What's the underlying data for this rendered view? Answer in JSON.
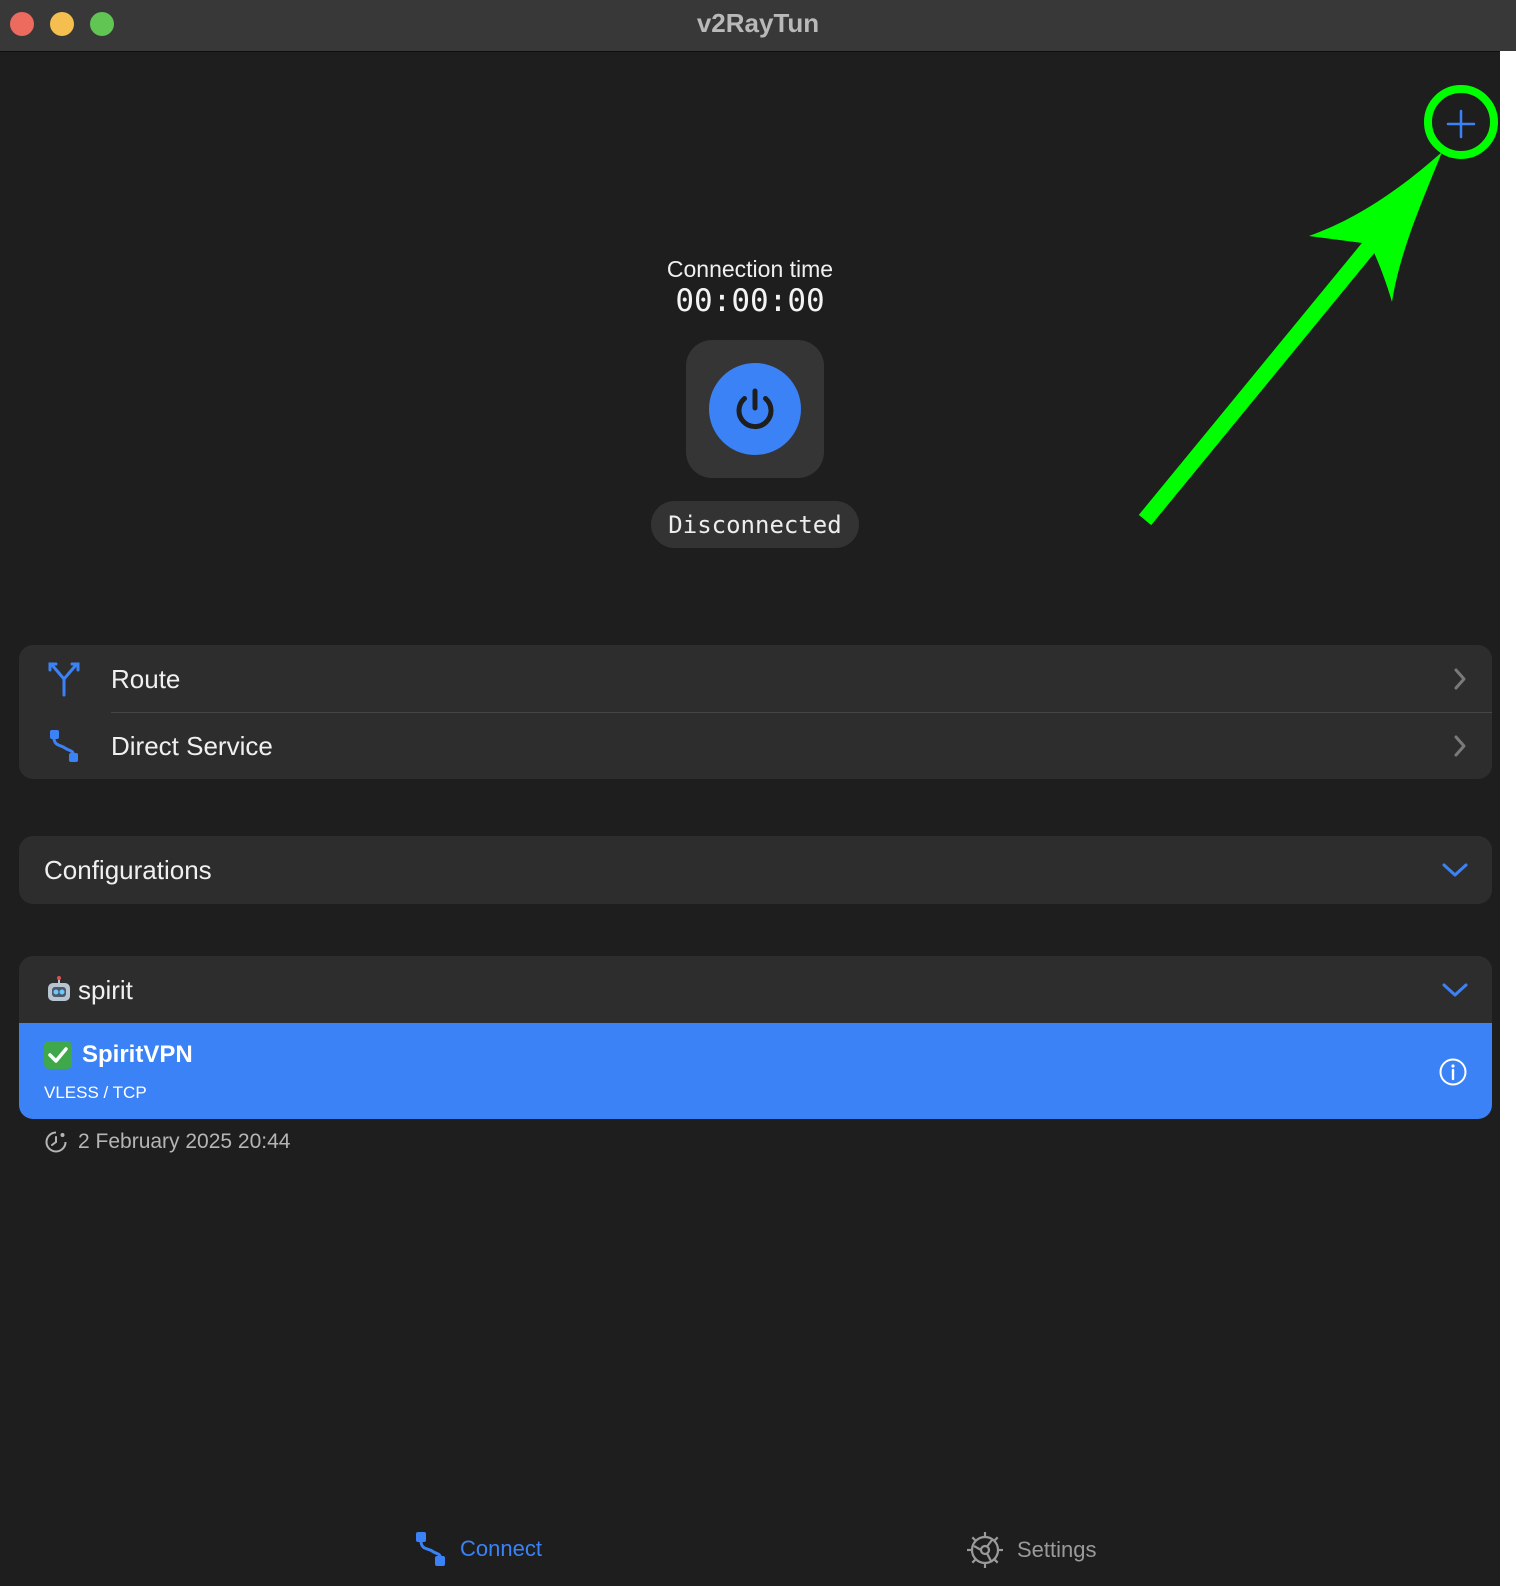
{
  "window": {
    "title": "v2RayTun"
  },
  "connection": {
    "label": "Connection time",
    "time": "00:00:00",
    "status": "Disconnected"
  },
  "menu": {
    "route_label": "Route",
    "direct_service_label": "Direct Service"
  },
  "configurations": {
    "label": "Configurations"
  },
  "group": {
    "name": "spirit",
    "icon": "robot-emoji-icon",
    "items": [
      {
        "name": "SpiritVPN",
        "protocol": "VLESS / TCP",
        "status_icon": "check-mark-emoji-icon"
      }
    ],
    "updated": "2 February 2025 20:44"
  },
  "tabs": {
    "connect_label": "Connect",
    "settings_label": "Settings"
  },
  "colors": {
    "accent": "#3b82f6",
    "annotation": "#00ff00",
    "background": "#1e1e1e",
    "card": "#2d2d2d"
  }
}
